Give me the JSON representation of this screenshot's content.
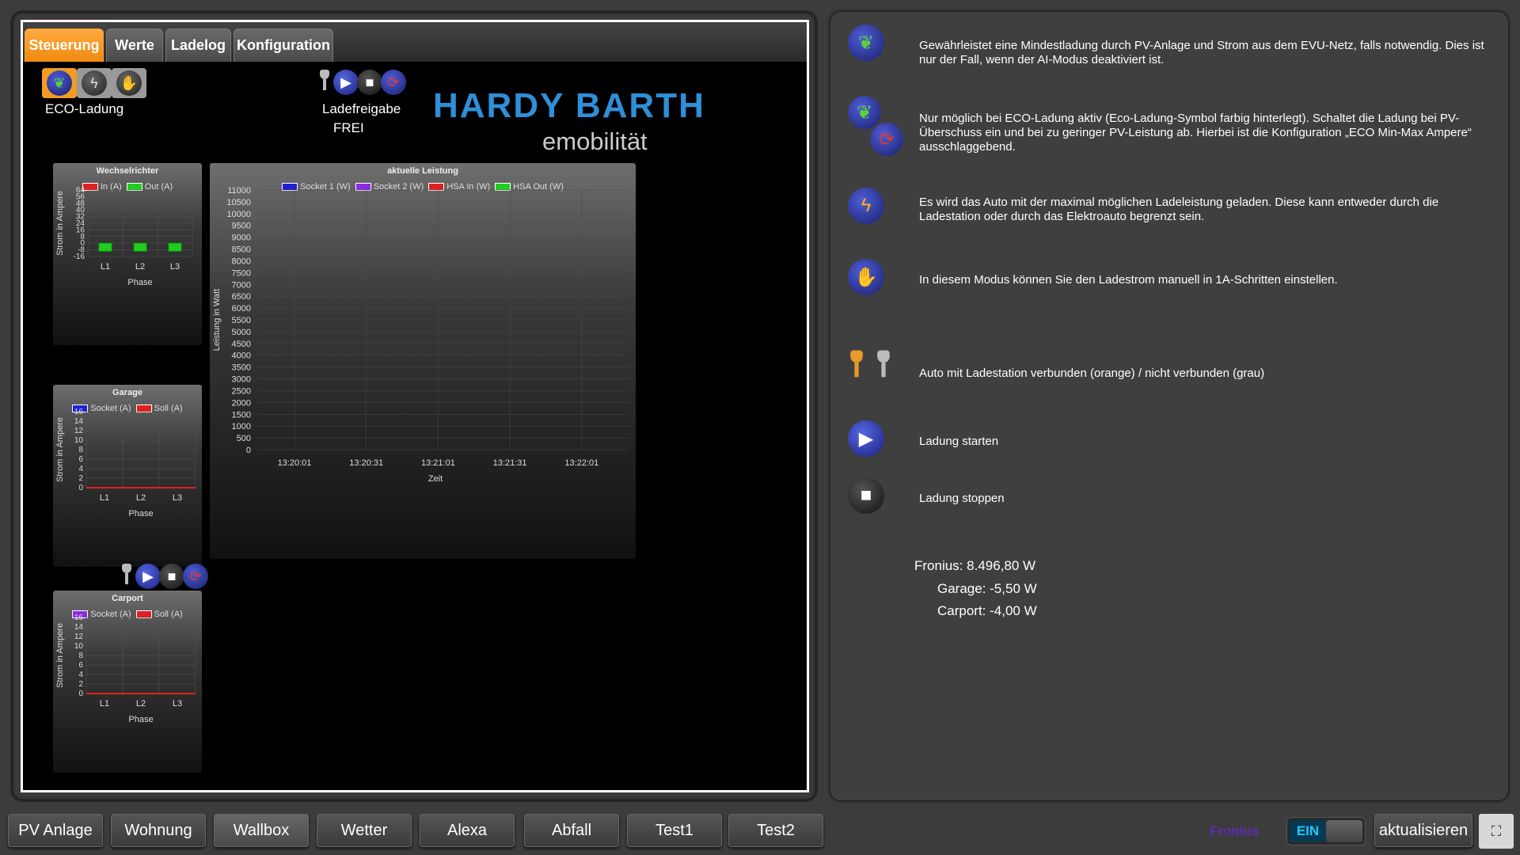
{
  "tabs": [
    {
      "label": "Steuerung",
      "active": true
    },
    {
      "label": "Werte",
      "active": false
    },
    {
      "label": "Ladelog",
      "active": false
    },
    {
      "label": "Konfiguration",
      "active": false
    }
  ],
  "mode": {
    "label": "ECO-Ladung"
  },
  "charge_release": {
    "label": "Ladefreigabe",
    "value": "FREI"
  },
  "logo": {
    "line1": "HARDY BARTH",
    "line2": "emobilität",
    "color": "#2f8fd8"
  },
  "charts": {
    "wechselrichter": {
      "title": "Wechselrichter",
      "legend": [
        {
          "name": "In (A)",
          "color": "#e02020"
        },
        {
          "name": "Out (A)",
          "color": "#22cc22"
        }
      ],
      "yticks": [
        "64",
        "56",
        "48",
        "40",
        "32",
        "24",
        "16",
        "8",
        "0",
        "-8",
        "-16"
      ],
      "ylabel": "Strom in Ampere",
      "xlabel": "Phase",
      "xticks": [
        "L1",
        "L2",
        "L3"
      ]
    },
    "garage": {
      "title": "Garage",
      "legend": [
        {
          "name": "Socket (A)",
          "color": "#2020d0"
        },
        {
          "name": "Soll (A)",
          "color": "#e02020"
        }
      ],
      "yticks": [
        "16",
        "14",
        "12",
        "10",
        "8",
        "6",
        "4",
        "2",
        "0"
      ],
      "ylabel": "Strom in Ampere",
      "xlabel": "Phase",
      "xticks": [
        "L1",
        "L2",
        "L3"
      ]
    },
    "carport": {
      "title": "Carport",
      "legend": [
        {
          "name": "Socket (A)",
          "color": "#8a2be2"
        },
        {
          "name": "Soll (A)",
          "color": "#e02020"
        }
      ],
      "yticks": [
        "16",
        "14",
        "12",
        "10",
        "8",
        "6",
        "4",
        "2",
        "0"
      ],
      "ylabel": "Strom in Ampere",
      "xlabel": "Phase",
      "xticks": [
        "L1",
        "L2",
        "L3"
      ]
    },
    "leistung": {
      "title": "aktuelle Leistung",
      "legend": [
        {
          "name": "Socket 1 (W)",
          "color": "#2020d0"
        },
        {
          "name": "Socket 2 (W)",
          "color": "#8a2be2"
        },
        {
          "name": "HSA In (W)",
          "color": "#e02020"
        },
        {
          "name": "HSA Out (W)",
          "color": "#22cc22"
        }
      ],
      "yticks": [
        "11000",
        "10500",
        "10000",
        "9500",
        "9000",
        "8500",
        "8000",
        "7500",
        "7000",
        "6500",
        "6000",
        "5500",
        "5000",
        "4500",
        "4000",
        "3500",
        "3000",
        "2500",
        "2000",
        "1500",
        "1000",
        "500",
        "0"
      ],
      "ylabel": "Leistung in Watt",
      "xlabel": "Zeit",
      "xticks": [
        "13:20:01",
        "13:20:31",
        "13:21:01",
        "13:21:31",
        "13:22:01"
      ]
    }
  },
  "chart_data": [
    {
      "type": "bar",
      "title": "Wechselrichter",
      "categories": [
        "L1",
        "L2",
        "L3"
      ],
      "series": [
        {
          "name": "In (A)",
          "values": [
            0,
            0,
            0
          ]
        },
        {
          "name": "Out (A)",
          "values": [
            -3,
            -3,
            -3
          ]
        }
      ],
      "xlabel": "Phase",
      "ylabel": "Strom in Ampere",
      "ylim": [
        -16,
        64
      ]
    },
    {
      "type": "bar",
      "title": "Garage",
      "categories": [
        "L1",
        "L2",
        "L3"
      ],
      "series": [
        {
          "name": "Socket (A)",
          "values": [
            0,
            0,
            0
          ]
        },
        {
          "name": "Soll (A)",
          "values": [
            0,
            0,
            0
          ]
        }
      ],
      "xlabel": "Phase",
      "ylabel": "Strom in Ampere",
      "ylim": [
        0,
        16
      ]
    },
    {
      "type": "bar",
      "title": "Carport",
      "categories": [
        "L1",
        "L2",
        "L3"
      ],
      "series": [
        {
          "name": "Socket (A)",
          "values": [
            0,
            0,
            0
          ]
        },
        {
          "name": "Soll (A)",
          "values": [
            0,
            0,
            0
          ]
        }
      ],
      "xlabel": "Phase",
      "ylabel": "Strom in Ampere",
      "ylim": [
        0,
        16
      ]
    },
    {
      "type": "line",
      "title": "aktuelle Leistung",
      "categories": [
        "13:20:01",
        "13:20:31",
        "13:21:01",
        "13:21:31",
        "13:22:01"
      ],
      "series": [
        {
          "name": "Socket 1 (W)",
          "values": []
        },
        {
          "name": "Socket 2 (W)",
          "values": []
        },
        {
          "name": "HSA In (W)",
          "values": []
        },
        {
          "name": "HSA Out (W)",
          "values": []
        }
      ],
      "xlabel": "Zeit",
      "ylabel": "Leistung in Watt",
      "ylim": [
        0,
        11000
      ]
    }
  ],
  "legend_rows": [
    {
      "text": "Gewährleistet eine Mindestladung durch PV-Anlage und Strom aus dem EVU-Netz, falls notwendig. Dies ist nur der Fall, wenn der AI-Modus deaktiviert ist."
    },
    {
      "text": "Nur möglich bei ECO-Ladung aktiv (Eco-Ladung-Symbol farbig hinterlegt). Schaltet die Ladung bei PV-Überschuss ein und bei zu geringer PV-Leistung ab. Hierbei ist die Konfiguration „ECO Min-Max Ampere“ ausschlaggebend."
    },
    {
      "text": "Es wird das Auto mit der maximal möglichen Ladeleistung geladen. Diese kann entweder durch die Ladestation oder durch das Elektroauto begrenzt sein."
    },
    {
      "text": "In diesem Modus können Sie den Ladestrom manuell in 1A-Schritten einstellen."
    },
    {
      "text": "Auto mit Ladestation verbunden (orange) / nicht verbunden (grau)"
    },
    {
      "text": "Ladung starten"
    },
    {
      "text": "Ladung stoppen"
    }
  ],
  "power_status": {
    "fronius": "Fronius: 8.496,80 W",
    "garage": "Garage: -5,50 W",
    "carport": "Carport: -4,00 W"
  },
  "nav": [
    {
      "label": "PV Anlage"
    },
    {
      "label": "Wohnung"
    },
    {
      "label": "Wallbox"
    },
    {
      "label": "Wetter"
    },
    {
      "label": "Alexa"
    },
    {
      "label": "Abfall"
    },
    {
      "label": "Test1"
    },
    {
      "label": "Test2"
    }
  ],
  "fronius_label": "Fronius",
  "toggle_label": "EIN",
  "refresh_label": "aktualisieren"
}
